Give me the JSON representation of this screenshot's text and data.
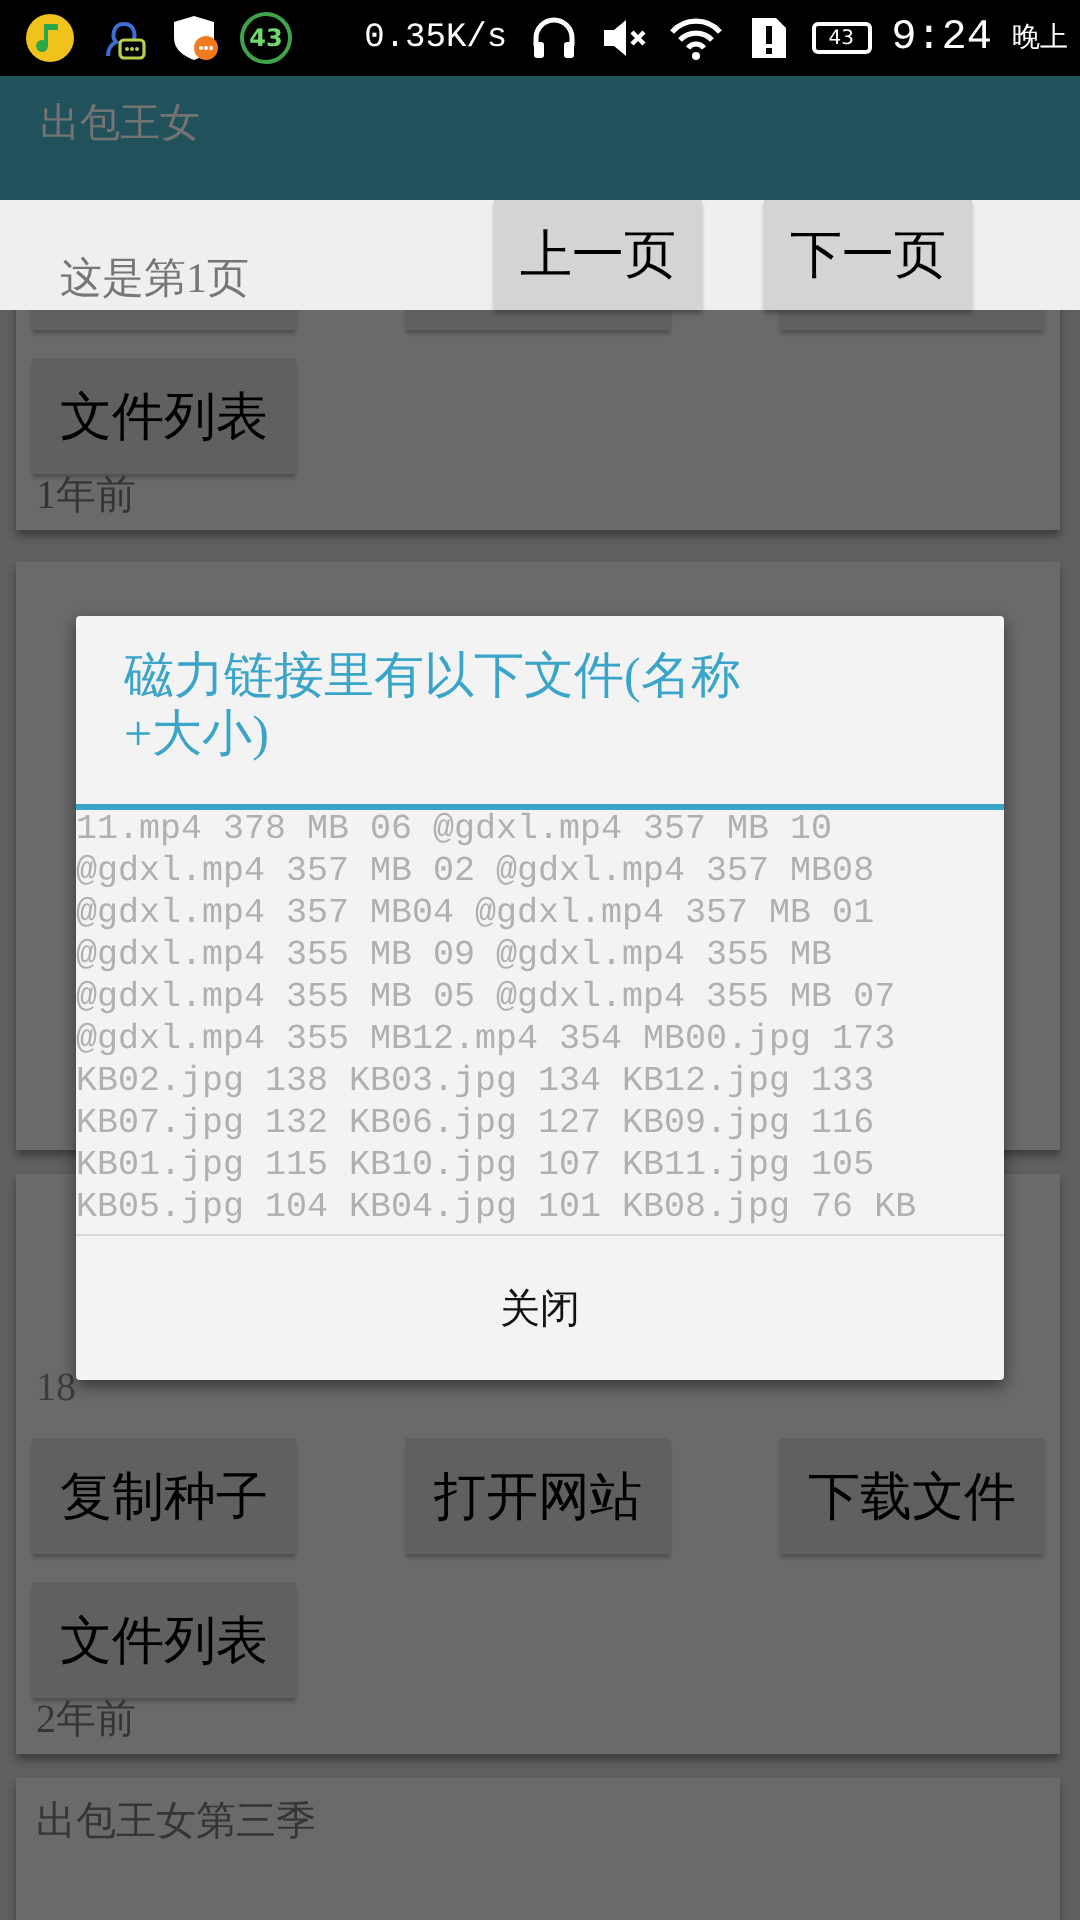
{
  "status_bar": {
    "notification_badge": "43",
    "net_speed": "0.35K/s",
    "battery": "43",
    "time": "9:24",
    "period": "晚上"
  },
  "app_bar": {
    "title": "出包王女"
  },
  "pager": {
    "page_label": "这是第1页",
    "buttons": [
      {
        "label": "上一页"
      },
      {
        "label": "下一页"
      }
    ]
  },
  "cards": [
    {
      "kind": "clipped",
      "buttons": [
        "文件列表"
      ],
      "age": "1年前"
    },
    {
      "kind": "covered"
    },
    {
      "kind": "full",
      "lines": [
        "18"
      ],
      "buttons": [
        "复制种子",
        "打开网站",
        "下载文件",
        "文件列表"
      ],
      "age": "2年前"
    },
    {
      "kind": "title",
      "title": "出包王女第三季"
    }
  ],
  "dialog": {
    "title": "磁力链接里有以下文件(名称+大小)",
    "body": "11.mp4 378 MB 06 @gdxl.mp4 357 MB 10\n@gdxl.mp4 357 MB 02 @gdxl.mp4 357 MB08\n@gdxl.mp4 357 MB04 @gdxl.mp4 357 MB 01\n@gdxl.mp4 355 MB 09 @gdxl.mp4 355 MB\n@gdxl.mp4 355 MB 05 @gdxl.mp4 355 MB 07\n@gdxl.mp4 355 MB12.mp4 354 MB00.jpg 173\nKB02.jpg 138 KB03.jpg 134 KB12.jpg 133\nKB07.jpg 132 KB06.jpg 127 KB09.jpg 116\nKB01.jpg 115 KB10.jpg 107 KB11.jpg 105\nKB05.jpg 104 KB04.jpg 101 KB08.jpg 76 KB",
    "button": "关闭"
  }
}
